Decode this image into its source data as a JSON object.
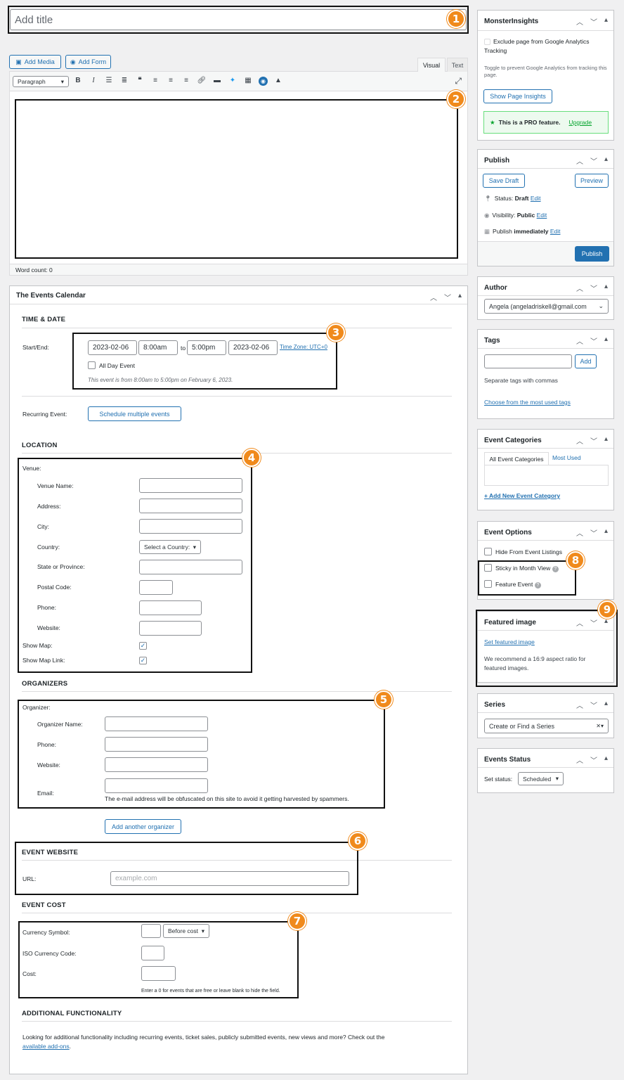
{
  "title_input": {
    "placeholder": "Add title"
  },
  "media": {
    "add_media": "Add Media",
    "add_form": "Add Form"
  },
  "editor": {
    "tab_visual": "Visual",
    "tab_text": "Text",
    "format": "Paragraph",
    "word_count": "Word count: 0"
  },
  "events_calendar": {
    "title": "The Events Calendar",
    "time_date_heading": "TIME & DATE",
    "start_end_label": "Start/End:",
    "start_date": "2023-02-06",
    "start_time": "8:00am",
    "to": "to",
    "end_time": "5:00pm",
    "end_date": "2023-02-06",
    "timezone": "Time Zone: UTC+0",
    "all_day": "All Day Event",
    "summary": "This event is from 8:00am to 5:00pm on February 6, 2023.",
    "recurring_label": "Recurring Event:",
    "schedule_btn": "Schedule multiple events",
    "location_heading": "LOCATION",
    "venue_label": "Venue:",
    "venue_fields": [
      "Venue Name:",
      "Address:",
      "City:",
      "Country:",
      "State or Province:",
      "Postal Code:",
      "Phone:",
      "Website:"
    ],
    "country_select": "Select a Country:",
    "show_map": "Show Map:",
    "show_map_link": "Show Map Link:",
    "organizers_heading": "ORGANIZERS",
    "organizer_label": "Organizer:",
    "organizer_fields": [
      "Organizer Name:",
      "Phone:",
      "Website:",
      "Email:"
    ],
    "email_note": "The e-mail address will be obfuscated on this site to avoid it getting harvested by spammers.",
    "add_organizer": "Add another organizer",
    "website_heading": "EVENT WEBSITE",
    "url_label": "URL:",
    "url_placeholder": "example.com",
    "cost_heading": "EVENT COST",
    "currency_symbol": "Currency Symbol:",
    "before_cost": "Before cost",
    "iso_code": "ISO Currency Code:",
    "cost": "Cost:",
    "cost_note": "Enter a 0 for events that are free or leave blank to hide the field.",
    "additional_heading": "ADDITIONAL FUNCTIONALITY",
    "additional_text": "Looking for additional functionality including recurring events, ticket sales, publicly submitted events, new views and more? Check out the",
    "addons_link": "available add-ons",
    "addons_end": "."
  },
  "sidebar": {
    "monster": {
      "title": "MonsterInsights",
      "exclude": "Exclude page from Google Analytics Tracking",
      "toggle_note": "Toggle to prevent Google Analytics from tracking this page.",
      "show_insights": "Show Page Insights",
      "pro": "This is a PRO feature.",
      "upgrade": "Upgrade"
    },
    "publish": {
      "title": "Publish",
      "save_draft": "Save Draft",
      "preview": "Preview",
      "status_label": "Status:",
      "status_value": "Draft",
      "visibility_label": "Visibility:",
      "visibility_value": "Public",
      "publish_label": "Publish",
      "publish_value": "immediately",
      "edit": "Edit",
      "publish_btn": "Publish"
    },
    "author": {
      "title": "Author",
      "value": "Angela (angeladriskell@gmail.com"
    },
    "tags": {
      "title": "Tags",
      "add": "Add",
      "note": "Separate tags with commas",
      "choose": "Choose from the most used tags"
    },
    "categories": {
      "title": "Event Categories",
      "tab_all": "All Event Categories",
      "tab_most": "Most Used",
      "add_new": "+ Add New Event Category"
    },
    "options": {
      "title": "Event Options",
      "hide": "Hide From Event Listings",
      "sticky": "Sticky in Month View",
      "feature": "Feature Event"
    },
    "featured": {
      "title": "Featured image",
      "set": "Set featured image",
      "note": "We recommend a 16:9 aspect ratio for featured images."
    },
    "series": {
      "title": "Series",
      "value": "Create or Find a Series"
    },
    "status": {
      "title": "Events Status",
      "label": "Set status:",
      "value": "Scheduled"
    }
  },
  "badges": [
    "1",
    "2",
    "3",
    "4",
    "5",
    "6",
    "7",
    "8",
    "9"
  ],
  "colors": {
    "accent": "#2271b1",
    "badge": "#f08a1c",
    "pro_green": "#00a32a"
  }
}
